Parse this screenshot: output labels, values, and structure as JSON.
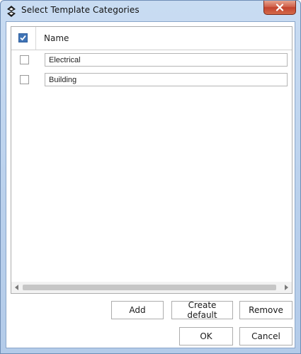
{
  "window": {
    "title": "Select Template Categories"
  },
  "grid": {
    "header_checked": true,
    "columns": [
      "Name"
    ],
    "rows": [
      {
        "checked": false,
        "name": "Electrical"
      },
      {
        "checked": false,
        "name": "Building"
      }
    ]
  },
  "buttons": {
    "add": "Add",
    "create_default": "Create default",
    "remove": "Remove",
    "ok": "OK",
    "cancel": "Cancel"
  },
  "colors": {
    "titlebar": "#bdd3ee",
    "close_button": "#c9513a",
    "checkbox_checked": "#3f73b5"
  }
}
